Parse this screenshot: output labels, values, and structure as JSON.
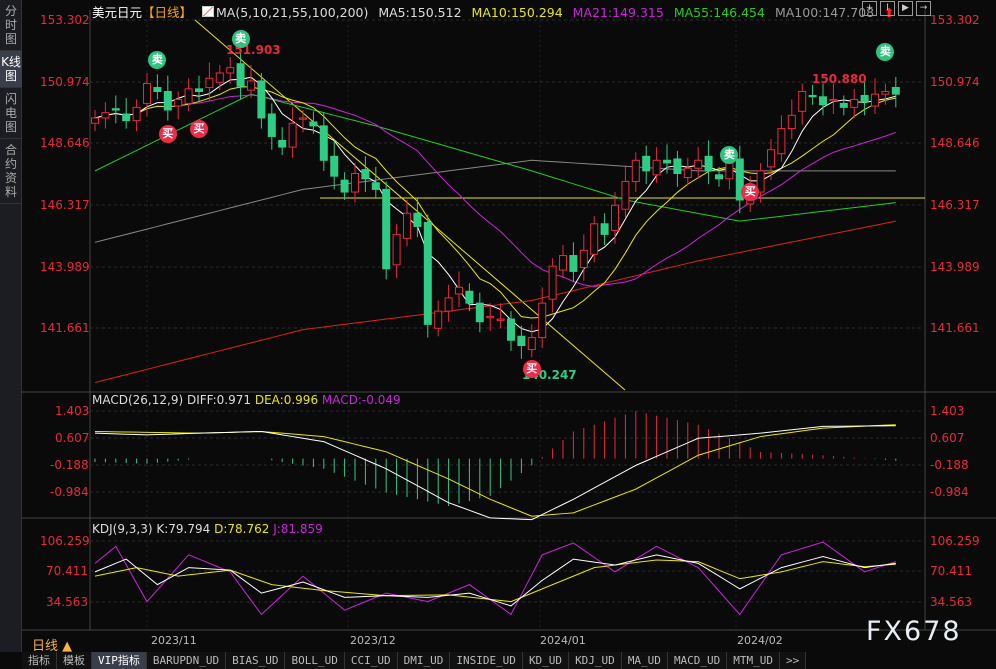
{
  "sidebar": [
    {
      "label": "分时图"
    },
    {
      "label": "K线图",
      "active": true
    },
    {
      "label": "闪电图"
    },
    {
      "label": "合约资料"
    }
  ],
  "header": {
    "symbol": "美元日元",
    "period": "【日线】",
    "ma_params": "MA(5,10,21,55,100,200)",
    "ma5": "MA5:150.512",
    "ma10": "MA10:150.294",
    "ma21": "MA21:149.315",
    "ma55": "MA55:146.454",
    "ma100": "MA100:147.708"
  },
  "toolbar": [
    "+",
    "I",
    "▶",
    "→"
  ],
  "price_axis": [
    "153.302",
    "150.974",
    "148.646",
    "146.317",
    "143.989",
    "141.661"
  ],
  "annotations": {
    "high1": "151.903",
    "high2": "150.880",
    "low": "140.247",
    "buy": "买",
    "sell": "卖"
  },
  "macd": {
    "title": "MACD(26,12,9)",
    "diff": "DIFF:0.971",
    "dea": "DEA:0.996",
    "macd": "MACD:-0.049",
    "axis": [
      "1.403",
      "0.607",
      "-0.188",
      "-0.984"
    ]
  },
  "kdj": {
    "title": "KDJ(9,3,3)",
    "k": "K:79.794",
    "d": "D:78.762",
    "j": "J:81.859",
    "axis": [
      "106.259",
      "70.411",
      "34.563"
    ]
  },
  "period_selector": "日线 ▲",
  "dates": [
    "2023/11",
    "2023/12",
    "2024/01",
    "2024/02"
  ],
  "tabs": [
    "指标",
    "模板",
    "VIP指标",
    "BARUPDN_UD",
    "BIAS_UD",
    "BOLL_UD",
    "CCI_UD",
    "DMI_UD",
    "INSIDE_UD",
    "KD_UD",
    "KDJ_UD",
    "MA_UD",
    "MACD_UD",
    "MTM_UD",
    ">>"
  ],
  "watermark": "FX678",
  "colors": {
    "up": "#e8283c",
    "down": "#2ecc85",
    "ma5": "#ffffff",
    "ma10": "#e8e800",
    "ma21": "#cc22dd",
    "ma55": "#22cc22",
    "ma100": "#888888",
    "ma200": "#dd2222"
  },
  "chart_data": {
    "type": "candlestick",
    "closes": [
      149.6,
      149.8,
      149.9,
      149.5,
      150.0,
      150.9,
      150.6,
      149.9,
      150.3,
      150.7,
      150.6,
      151.1,
      151.3,
      151.5,
      150.8,
      151.0,
      149.6,
      148.9,
      148.5,
      149.4,
      149.6,
      149.3,
      148.0,
      147.4,
      146.8,
      147.5,
      147.3,
      146.9,
      143.9,
      145.2,
      146.0,
      145.5,
      141.8,
      142.3,
      142.8,
      143.2,
      142.6,
      141.9,
      142.1,
      142.0,
      141.2,
      141.0,
      141.3,
      142.6,
      144.0,
      144.4,
      143.8,
      144.6,
      145.6,
      145.2,
      146.3,
      147.2,
      148.0,
      147.6,
      148.0,
      147.9,
      147.5,
      147.7,
      148.0,
      147.6,
      147.3,
      147.9,
      146.5,
      146.8,
      147.6,
      148.4,
      149.2,
      149.7,
      150.6,
      150.4,
      150.1,
      150.3,
      150.0,
      150.3,
      150.2,
      150.5,
      150.6,
      150.5
    ],
    "ma55": [
      [
        0,
        147.6
      ],
      [
        15,
        150.5
      ],
      [
        27,
        149.3
      ],
      [
        42,
        147.6
      ],
      [
        51,
        146.5
      ],
      [
        62,
        145.7
      ],
      [
        77,
        146.4
      ]
    ],
    "ma100": [
      [
        0,
        144.9
      ],
      [
        20,
        146.9
      ],
      [
        42,
        148.0
      ],
      [
        58,
        147.6
      ],
      [
        77,
        147.6
      ]
    ],
    "ma200": [
      [
        0,
        139.6
      ],
      [
        20,
        141.6
      ],
      [
        42,
        142.7
      ],
      [
        58,
        144.2
      ],
      [
        77,
        145.7
      ]
    ],
    "signals": [
      [
        7,
        "buy",
        149.0
      ],
      [
        6,
        "sell",
        151.8
      ],
      [
        10,
        "buy",
        149.2
      ],
      [
        14,
        "sell",
        152.6
      ],
      [
        42,
        "buy",
        140.1
      ],
      [
        61,
        "sell",
        148.2
      ],
      [
        63,
        "buy",
        146.8
      ],
      [
        76,
        "sell",
        152.1
      ]
    ],
    "macd_diff": [
      [
        0,
        0.75
      ],
      [
        5,
        0.7
      ],
      [
        10,
        0.75
      ],
      [
        16,
        0.8
      ],
      [
        22,
        0.5
      ],
      [
        28,
        -0.3
      ],
      [
        34,
        -1.3
      ],
      [
        38,
        -1.75
      ],
      [
        42,
        -1.8
      ],
      [
        46,
        -1.2
      ],
      [
        52,
        -0.2
      ],
      [
        58,
        0.6
      ],
      [
        64,
        0.75
      ],
      [
        70,
        0.95
      ],
      [
        77,
        0.97
      ]
    ],
    "macd_dea": [
      [
        0,
        0.8
      ],
      [
        10,
        0.75
      ],
      [
        16,
        0.8
      ],
      [
        22,
        0.65
      ],
      [
        28,
        0.2
      ],
      [
        34,
        -0.6
      ],
      [
        38,
        -1.2
      ],
      [
        42,
        -1.7
      ],
      [
        46,
        -1.6
      ],
      [
        52,
        -0.9
      ],
      [
        58,
        0.1
      ],
      [
        64,
        0.65
      ],
      [
        70,
        0.9
      ],
      [
        77,
        1.0
      ]
    ],
    "kdj_k": [
      [
        0,
        70
      ],
      [
        3,
        85
      ],
      [
        6,
        55
      ],
      [
        9,
        75
      ],
      [
        13,
        72
      ],
      [
        16,
        45
      ],
      [
        20,
        58
      ],
      [
        24,
        40
      ],
      [
        28,
        42
      ],
      [
        32,
        40
      ],
      [
        36,
        45
      ],
      [
        40,
        30
      ],
      [
        43,
        60
      ],
      [
        46,
        85
      ],
      [
        50,
        78
      ],
      [
        54,
        90
      ],
      [
        58,
        80
      ],
      [
        62,
        50
      ],
      [
        66,
        75
      ],
      [
        70,
        88
      ],
      [
        74,
        75
      ],
      [
        77,
        80
      ]
    ],
    "kdj_d": [
      [
        0,
        65
      ],
      [
        4,
        75
      ],
      [
        8,
        65
      ],
      [
        13,
        72
      ],
      [
        17,
        55
      ],
      [
        22,
        48
      ],
      [
        28,
        42
      ],
      [
        34,
        43
      ],
      [
        40,
        35
      ],
      [
        44,
        55
      ],
      [
        48,
        75
      ],
      [
        54,
        84
      ],
      [
        58,
        82
      ],
      [
        62,
        62
      ],
      [
        66,
        70
      ],
      [
        70,
        82
      ],
      [
        74,
        76
      ],
      [
        77,
        79
      ]
    ],
    "kdj_j": [
      [
        0,
        80
      ],
      [
        2,
        100
      ],
      [
        5,
        35
      ],
      [
        9,
        90
      ],
      [
        13,
        70
      ],
      [
        16,
        20
      ],
      [
        20,
        65
      ],
      [
        24,
        25
      ],
      [
        28,
        45
      ],
      [
        32,
        35
      ],
      [
        36,
        55
      ],
      [
        40,
        20
      ],
      [
        43,
        90
      ],
      [
        46,
        104
      ],
      [
        50,
        70
      ],
      [
        54,
        100
      ],
      [
        58,
        75
      ],
      [
        62,
        20
      ],
      [
        66,
        90
      ],
      [
        70,
        105
      ],
      [
        74,
        70
      ],
      [
        77,
        82
      ]
    ]
  }
}
